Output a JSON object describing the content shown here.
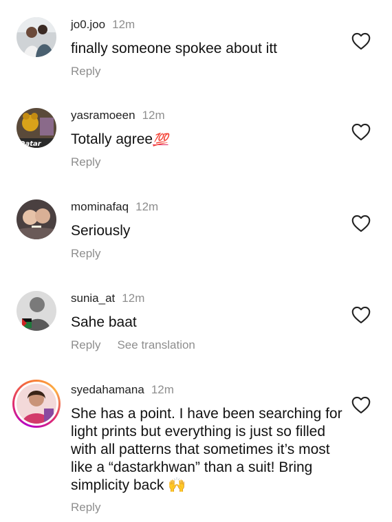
{
  "comments": [
    {
      "username": "jo0.joo",
      "time": "12m",
      "text": "finally someone spokee about itt",
      "reply": "Reply"
    },
    {
      "username": "yasramoeen",
      "time": "12m",
      "text": "Totally agree",
      "emoji": "💯",
      "avatar_text": "Qatar",
      "reply": "Reply"
    },
    {
      "username": "mominafaq",
      "time": "12m",
      "text": "Seriously",
      "reply": "Reply"
    },
    {
      "username": "sunia_at",
      "time": "12m",
      "text": "Sahe baat",
      "reply": "Reply",
      "translation": "See translation"
    },
    {
      "username": "syedahamana",
      "time": "12m",
      "text": "She has a point. I have been searching for light prints but everything is just so filled with all patterns that sometimes it’s most like a “dastarkhwan” than a suit! Bring simplicity back",
      "emoji": "🙌",
      "reply": "Reply",
      "has_story_ring": true
    }
  ],
  "colors": {
    "text": "#111111",
    "muted": "#8e8e8e",
    "heart_outline": "#222222"
  },
  "icons": [
    "heart-outline-icon"
  ]
}
